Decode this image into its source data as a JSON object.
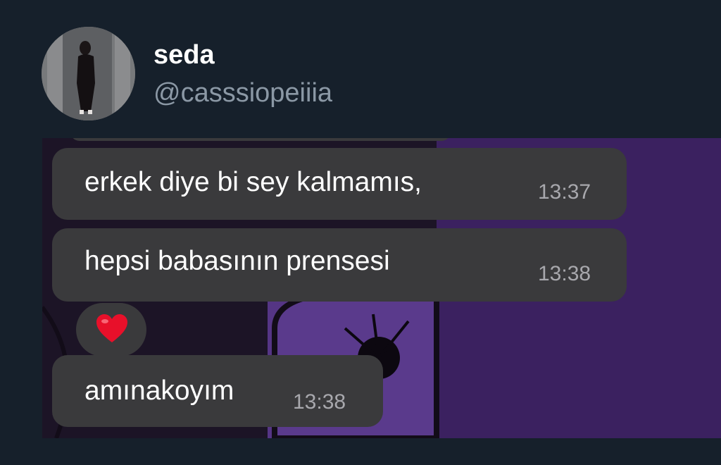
{
  "profile": {
    "display_name": "seda",
    "handle": "@casssiopeiiia"
  },
  "chat": {
    "messages": [
      {
        "text": "erkek diye bi sey kalmamıs,",
        "time": "13:37"
      },
      {
        "text": "hepsi babasının prensesi",
        "time": "13:38",
        "reaction": "heart"
      },
      {
        "text": "amınakoyım",
        "time": "13:38"
      }
    ]
  },
  "colors": {
    "background": "#16202b",
    "bubble": "#3a3a3c",
    "wallpaper": "#3a1f5c",
    "heart": "#e8102a"
  }
}
